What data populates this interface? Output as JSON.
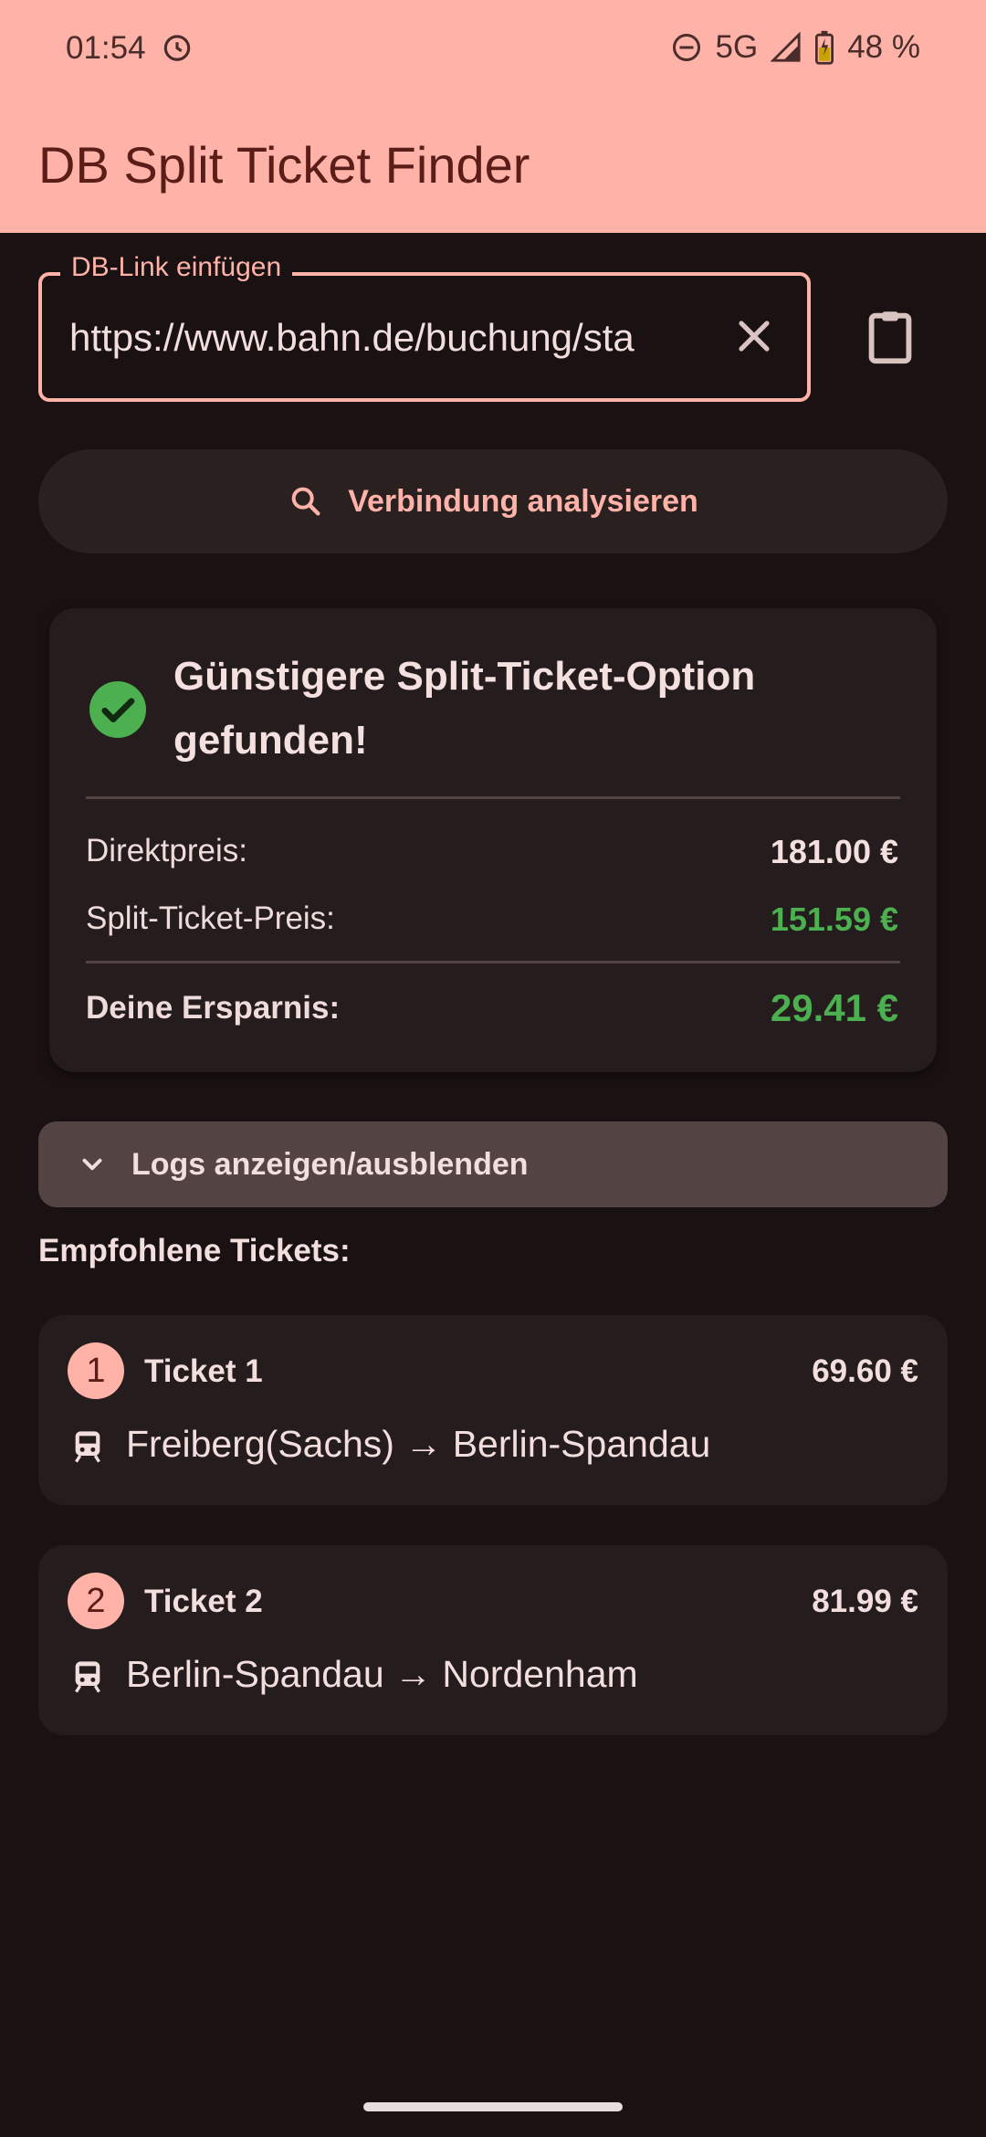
{
  "status": {
    "time": "01:54",
    "network": "5G",
    "battery": "48 %"
  },
  "app": {
    "title": "DB Split Ticket Finder"
  },
  "link_field": {
    "label": "DB-Link einfügen",
    "value": "https://www.bahn.de/buchung/sta"
  },
  "analyze": {
    "label": "Verbindung analysieren"
  },
  "result": {
    "title": "Günstigere Split-Ticket-Option gefunden!",
    "direct_label": "Direktpreis:",
    "direct_value": "181.00 €",
    "split_label": "Split-Ticket-Preis:",
    "split_value": "151.59 €",
    "savings_label": "Deine Ersparnis:",
    "savings_value": "29.41 €"
  },
  "logs": {
    "label": "Logs anzeigen/ausblenden"
  },
  "tickets_section": {
    "title": "Empfohlene Tickets:"
  },
  "tickets": [
    {
      "number": "1",
      "name": "Ticket 1",
      "price": "69.60 €",
      "route": "Freiberg(Sachs) → Berlin-Spandau"
    },
    {
      "number": "2",
      "name": "Ticket 2",
      "price": "81.99 €",
      "route": "Berlin-Spandau → Nordenham"
    }
  ],
  "colors": {
    "accent": "#ffb3a8",
    "success": "#4caf50",
    "background": "#1a1112"
  },
  "icons": [
    "alarm-icon",
    "dnd-icon",
    "signal-icon",
    "battery-icon",
    "clear-icon",
    "clipboard-icon",
    "search-icon",
    "check-circle-icon",
    "chevron-down-icon",
    "train-icon"
  ]
}
